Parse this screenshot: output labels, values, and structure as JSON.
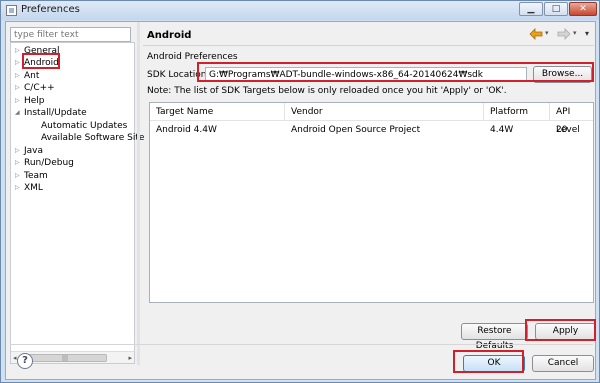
{
  "window": {
    "title": "Preferences",
    "minimize": "▁",
    "maximize": "□",
    "close": "✕"
  },
  "filter": {
    "placeholder": "type filter text"
  },
  "tree": {
    "items": [
      {
        "label": "General",
        "arrow": "▷"
      },
      {
        "label": "Android",
        "arrow": "▷"
      },
      {
        "label": "Ant",
        "arrow": "▷"
      },
      {
        "label": "C/C++",
        "arrow": "▷"
      },
      {
        "label": "Help",
        "arrow": "▷"
      },
      {
        "label": "Install/Update",
        "arrow": "◢"
      },
      {
        "label": "Automatic Updates",
        "arrow": ""
      },
      {
        "label": "Available Software Site",
        "arrow": ""
      },
      {
        "label": "Java",
        "arrow": "▷"
      },
      {
        "label": "Run/Debug",
        "arrow": "▷"
      },
      {
        "label": "Team",
        "arrow": "▷"
      },
      {
        "label": "XML",
        "arrow": "▷"
      }
    ],
    "scroll_left": "◂",
    "scroll_right": "▸",
    "scroll_grip": "|||"
  },
  "page": {
    "title": "Android",
    "menu_glyph": "▾",
    "dropdown_glyph": "▾",
    "prefs_label": "Android Preferences",
    "sdk_label": "SDK Location:",
    "sdk_value": "G:₩Programs₩ADT-bundle-windows-x86_64-20140624₩sdk",
    "browse": "Browse...",
    "note": "Note: The list of SDK Targets below is only reloaded once you hit 'Apply' or 'OK'."
  },
  "table": {
    "headers": [
      "Target Name",
      "Vendor",
      "Platform",
      "API Level"
    ],
    "rows": [
      [
        "Android 4.4W",
        "Android Open Source Project",
        "4.4W",
        "20"
      ]
    ]
  },
  "buttons": {
    "restore_defaults": "Restore Defaults",
    "apply": "Apply",
    "ok": "OK",
    "cancel": "Cancel",
    "help": "?"
  },
  "colors": {
    "highlight": "#d0202c",
    "nav_back": "#e6a21c",
    "nav_disabled": "#b8b8b8"
  },
  "icons": {
    "nav_back": "back-arrow-icon",
    "nav_forward": "forward-arrow-icon",
    "help": "help-icon",
    "app": "preferences-app-icon"
  }
}
